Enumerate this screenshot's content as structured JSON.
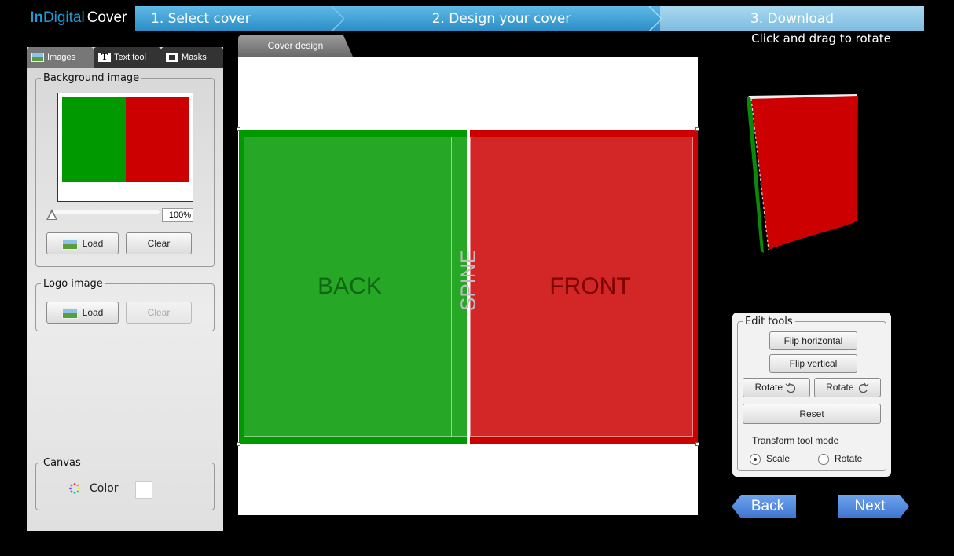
{
  "app": {
    "logo_in": "In",
    "logo_digital": "Digital",
    "logo_cover": "Cover"
  },
  "steps": [
    {
      "label": "1. Select cover",
      "state": "done"
    },
    {
      "label": "2. Design your cover",
      "state": "active"
    },
    {
      "label": "3. Download",
      "state": "upcoming"
    }
  ],
  "preview": {
    "hint": "Click and drag to rotate"
  },
  "left_panel": {
    "tabs": [
      {
        "label": "Images",
        "icon": "image-icon",
        "selected": true
      },
      {
        "label": "Text tool",
        "icon": "text-tool-icon",
        "selected": false
      },
      {
        "label": "Masks",
        "icon": "mask-icon",
        "selected": false
      }
    ],
    "background_group": {
      "title": "Background image",
      "zoom": "100%",
      "load_label": "Load",
      "clear_label": "Clear"
    },
    "logo_group": {
      "title": "Logo image",
      "load_label": "Load",
      "clear_label": "Clear"
    },
    "canvas_group": {
      "title": "Canvas",
      "color_label": "Color",
      "color_value": "#ffffff"
    }
  },
  "editor": {
    "tab_label": "Cover design",
    "back_label": "BACK",
    "spine_label": "SPINE",
    "front_label": "FRONT",
    "back_color": "#009900",
    "front_color": "#cc0000"
  },
  "edit_tools": {
    "title": "Edit tools",
    "flip_horizontal": "Flip horizontal",
    "flip_vertical": "Flip vertical",
    "rotate_ccw": "Rotate",
    "rotate_cw": "Rotate",
    "reset": "Reset",
    "mode_label": "Transform tool mode",
    "mode_scale": "Scale",
    "mode_rotate": "Rotate",
    "mode_selected": "Scale"
  },
  "nav": {
    "back": "Back",
    "next": "Next"
  }
}
